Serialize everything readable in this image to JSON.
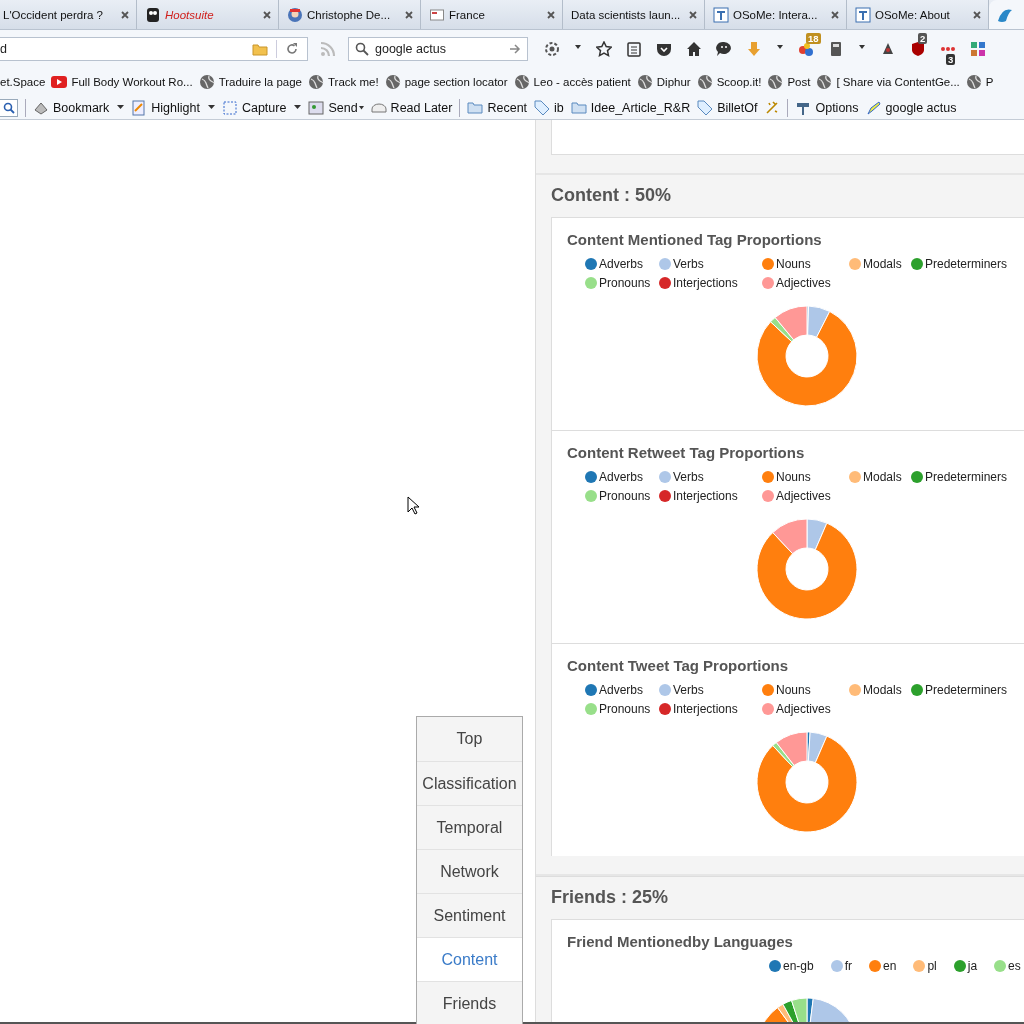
{
  "tabs": [
    {
      "label": "L'Occident perdra ?",
      "selected": false,
      "kind": "plain",
      "italic": false
    },
    {
      "label": "Hootsuite",
      "selected": false,
      "kind": "owl",
      "italic": true
    },
    {
      "label": "Christophe De...",
      "selected": false,
      "kind": "avatar",
      "italic": false
    },
    {
      "label": "France",
      "selected": false,
      "kind": "page",
      "italic": false
    },
    {
      "label": "Data scientists laun...",
      "selected": false,
      "kind": "plain",
      "italic": false
    },
    {
      "label": "OSoMe: Intera...",
      "selected": false,
      "kind": "letter",
      "italic": false
    },
    {
      "label": "OSoMe: About",
      "selected": false,
      "kind": "letter",
      "italic": false
    },
    {
      "selected": true,
      "kind": "bird"
    }
  ],
  "nav_bar": {
    "url_value": "d",
    "search_value": "google actus",
    "badges": [
      "18",
      "2",
      "3"
    ]
  },
  "bookmarks": [
    {
      "label": "et.Space",
      "kind": "plain"
    },
    {
      "label": "Full Body Workout Ro...",
      "kind": "video"
    },
    {
      "label": "Traduire la page",
      "kind": "globe"
    },
    {
      "label": "Track me!",
      "kind": "globe"
    },
    {
      "label": "page section locator",
      "kind": "globe"
    },
    {
      "label": "Leo - accès patient",
      "kind": "globe"
    },
    {
      "label": "Diphur",
      "kind": "globe"
    },
    {
      "label": "Scoop.it!",
      "kind": "globe"
    },
    {
      "label": "Post",
      "kind": "globe"
    },
    {
      "label": "[ Share via ContentGe...",
      "kind": "globe"
    },
    {
      "label": "P",
      "kind": "globe"
    }
  ],
  "addon_bar": [
    {
      "label": "Bookmark",
      "kind": "dropdown"
    },
    {
      "label": "Highlight",
      "kind": "dropdown"
    },
    {
      "label": "Capture",
      "kind": "dropdown"
    },
    {
      "label": "Send",
      "kind": "menu"
    },
    {
      "label": "Read Later",
      "kind": "plain"
    },
    {
      "label": "Recent",
      "kind": "folder"
    },
    {
      "label": "ib",
      "kind": "tag"
    },
    {
      "label": "Idee_Article_R&R",
      "kind": "folder"
    },
    {
      "label": "BilletOf",
      "kind": "tag"
    },
    {
      "label": "Options",
      "kind": "plain"
    },
    {
      "label": "google  actus",
      "kind": "plain"
    }
  ],
  "side_nav": [
    {
      "label": "Top",
      "selected": false
    },
    {
      "label": "Classification",
      "selected": false
    },
    {
      "label": "Temporal",
      "selected": false
    },
    {
      "label": "Network",
      "selected": false
    },
    {
      "label": "Sentiment",
      "selected": false
    },
    {
      "label": "Content",
      "selected": true
    },
    {
      "label": "Friends",
      "selected": false
    }
  ],
  "sections": [
    {
      "title": "Content : 50%",
      "cards": [
        {
          "title": "Content Mentioned Tag Proportions",
          "kind": "grid",
          "legend": [
            {
              "label": "Adverbs",
              "color": "#1f77b4"
            },
            {
              "label": "Verbs",
              "color": "#aec7e8"
            },
            {
              "label": "Nouns",
              "color": "#ff7f0e"
            },
            {
              "label": "Modals",
              "color": "#ffbb78"
            },
            {
              "label": "Predeterminers",
              "color": "#2ca02c"
            },
            {
              "label": "Pronouns",
              "color": "#98df8a"
            },
            {
              "label": "Interjections",
              "color": "#d62728"
            },
            {
              "label": "Adjectives",
              "color": "#ff9896"
            }
          ]
        },
        {
          "title": "Content Retweet Tag Proportions",
          "kind": "grid",
          "legend": [
            {
              "label": "Adverbs",
              "color": "#1f77b4"
            },
            {
              "label": "Verbs",
              "color": "#aec7e8"
            },
            {
              "label": "Nouns",
              "color": "#ff7f0e"
            },
            {
              "label": "Modals",
              "color": "#ffbb78"
            },
            {
              "label": "Predeterminers",
              "color": "#2ca02c"
            },
            {
              "label": "Pronouns",
              "color": "#98df8a"
            },
            {
              "label": "Interjections",
              "color": "#d62728"
            },
            {
              "label": "Adjectives",
              "color": "#ff9896"
            }
          ]
        },
        {
          "title": "Content Tweet Tag Proportions",
          "kind": "grid",
          "legend": [
            {
              "label": "Adverbs",
              "color": "#1f77b4"
            },
            {
              "label": "Verbs",
              "color": "#aec7e8"
            },
            {
              "label": "Nouns",
              "color": "#ff7f0e"
            },
            {
              "label": "Modals",
              "color": "#ffbb78"
            },
            {
              "label": "Predeterminers",
              "color": "#2ca02c"
            },
            {
              "label": "Pronouns",
              "color": "#98df8a"
            },
            {
              "label": "Interjections",
              "color": "#d62728"
            },
            {
              "label": "Adjectives",
              "color": "#ff9896"
            }
          ]
        }
      ]
    },
    {
      "title": "Friends : 25%",
      "cards": [
        {
          "title": "Friend Mentionedby Languages",
          "kind": "row",
          "legend": [
            {
              "label": "en-gb",
              "color": "#1f77b4"
            },
            {
              "label": "fr",
              "color": "#aec7e8"
            },
            {
              "label": "en",
              "color": "#ff7f0e"
            },
            {
              "label": "pl",
              "color": "#ffbb78"
            },
            {
              "label": "ja",
              "color": "#2ca02c"
            },
            {
              "label": "es",
              "color": "#98df8a"
            }
          ]
        }
      ]
    }
  ]
}
